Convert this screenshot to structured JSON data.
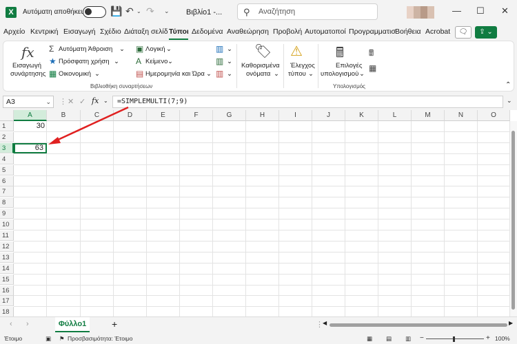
{
  "titlebar": {
    "autosave_label": "Αυτόματη αποθήκευση",
    "filename": "Βιβλίο1 -...",
    "search_placeholder": "Αναζήτηση",
    "minimize": "—",
    "maximize": "☐",
    "close": "✕"
  },
  "tabs": [
    "Αρχείο",
    "Κεντρική",
    "Εισαγωγή",
    "Σχέδιο",
    "Διάταξη σελίδ",
    "Τύποι",
    "Δεδομένα",
    "Αναθεώρηση",
    "Προβολή",
    "Αυτοματοποί",
    "Προγραμματισ",
    "Βοήθεια",
    "Acrobat"
  ],
  "ribbon": {
    "insert_function": [
      "Εισαγωγή",
      "συνάρτησης"
    ],
    "autosum": "Αυτόματη Άθροιση",
    "recent": "Πρόσφατη χρήση",
    "financial": "Οικονομική",
    "logical": "Λογική",
    "text": "Κείμενο",
    "datetime": "Ημερομηνία και Ώρα",
    "library_label": "Βιβλιοθήκη συναρτήσεων",
    "defined_names": [
      "Καθορισμένα",
      "ονόματα"
    ],
    "formula_auditing": [
      "Έλεγχος",
      "τύπου"
    ],
    "calc_options": [
      "Επιλογές",
      "υπολογισμού"
    ],
    "calc_label": "Υπολογισμός"
  },
  "formula_bar": {
    "name_box": "A3",
    "fx": "fx",
    "formula": "=SIMPLEMULTI(7;9)"
  },
  "grid": {
    "columns": [
      "A",
      "B",
      "C",
      "D",
      "E",
      "F",
      "G",
      "H",
      "I",
      "J",
      "K",
      "L",
      "M",
      "N",
      "O"
    ],
    "rows": [
      "1",
      "2",
      "3",
      "4",
      "5",
      "6",
      "7",
      "8",
      "9",
      "10",
      "11",
      "12",
      "13",
      "14",
      "15",
      "16",
      "17",
      "18"
    ],
    "cells": {
      "A1": "30",
      "A3": "63"
    }
  },
  "sheets": {
    "active": "Φύλλο1",
    "add": "+"
  },
  "status": {
    "ready": "Έτοιμο",
    "accessibility": "Προσβασιμότητα: Έτοιμο",
    "zoom": "100%",
    "zoom_minus": "−",
    "zoom_plus": "+"
  },
  "colors": {
    "accent": "#107c41",
    "arrow": "#e02020"
  }
}
